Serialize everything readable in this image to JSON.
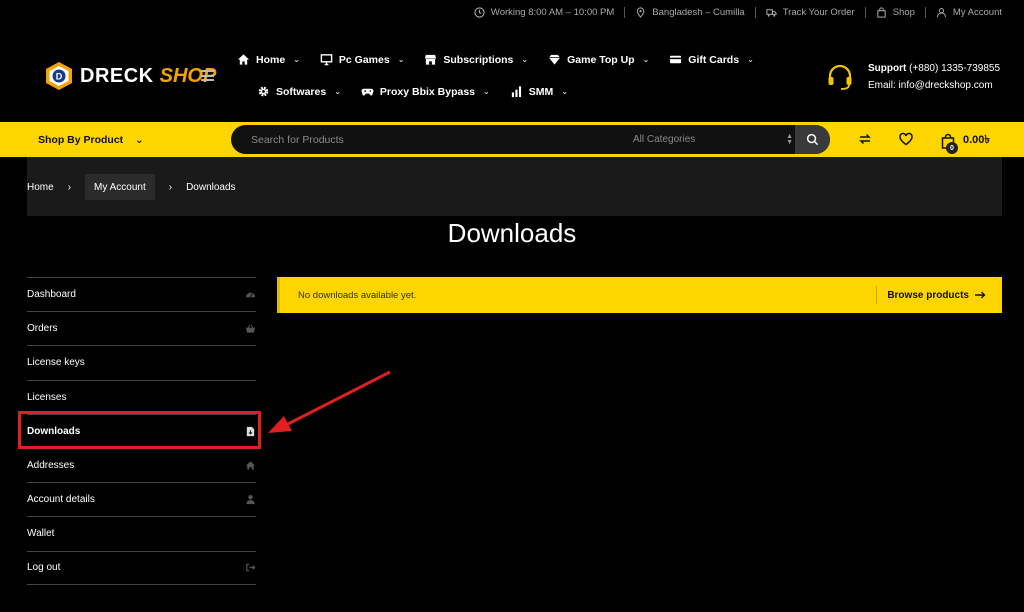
{
  "topbar": {
    "hours": "Working 8:00 AM – 10:00 PM",
    "location": "Bangladesh – Cumilla",
    "track_order": "Track Your Order",
    "shop": "Shop",
    "my_account": "My Account"
  },
  "logo": {
    "part1": "DRECK",
    "part2": "SHOP",
    "accent_color": "#f5a300"
  },
  "nav": {
    "row1": [
      {
        "label": "Home",
        "icon": "home-icon"
      },
      {
        "label": "Pc Games",
        "icon": "monitor-icon"
      },
      {
        "label": "Subscriptions",
        "icon": "store-icon"
      },
      {
        "label": "Game Top Up",
        "icon": "diamond-icon"
      },
      {
        "label": "Gift Cards",
        "icon": "card-icon"
      }
    ],
    "row2": [
      {
        "label": "Softwares",
        "icon": "gear-icon"
      },
      {
        "label": "Proxy Bbix Bypass",
        "icon": "gamepad-icon"
      },
      {
        "label": "SMM",
        "icon": "bar-chart-icon"
      }
    ]
  },
  "support": {
    "label": "Support",
    "phone": "(+880) 1335-739855",
    "email": "Email: info@dreckshop.com"
  },
  "searchbar": {
    "shop_by": "Shop By Product",
    "placeholder": "Search for Products",
    "category": "All Categories",
    "cart_count": "0",
    "cart_total": "0.00৳",
    "brand_color": "#ffd500"
  },
  "breadcrumb": {
    "home": "Home",
    "account": "My Account",
    "current": "Downloads"
  },
  "page_title": "Downloads",
  "account_nav": [
    {
      "label": "Dashboard",
      "icon": "dashboard-icon"
    },
    {
      "label": "Orders",
      "icon": "basket-icon"
    },
    {
      "label": "License keys",
      "icon": ""
    },
    {
      "label": "Licenses",
      "icon": ""
    },
    {
      "label": "Downloads",
      "icon": "file-download-icon",
      "active": true
    },
    {
      "label": "Addresses",
      "icon": "home-icon"
    },
    {
      "label": "Account details",
      "icon": "user-icon"
    },
    {
      "label": "Wallet",
      "icon": ""
    },
    {
      "label": "Log out",
      "icon": "logout-icon"
    }
  ],
  "notice": {
    "message": "No downloads available yet.",
    "button": "Browse products"
  },
  "annotation_color": "#e01f1f"
}
